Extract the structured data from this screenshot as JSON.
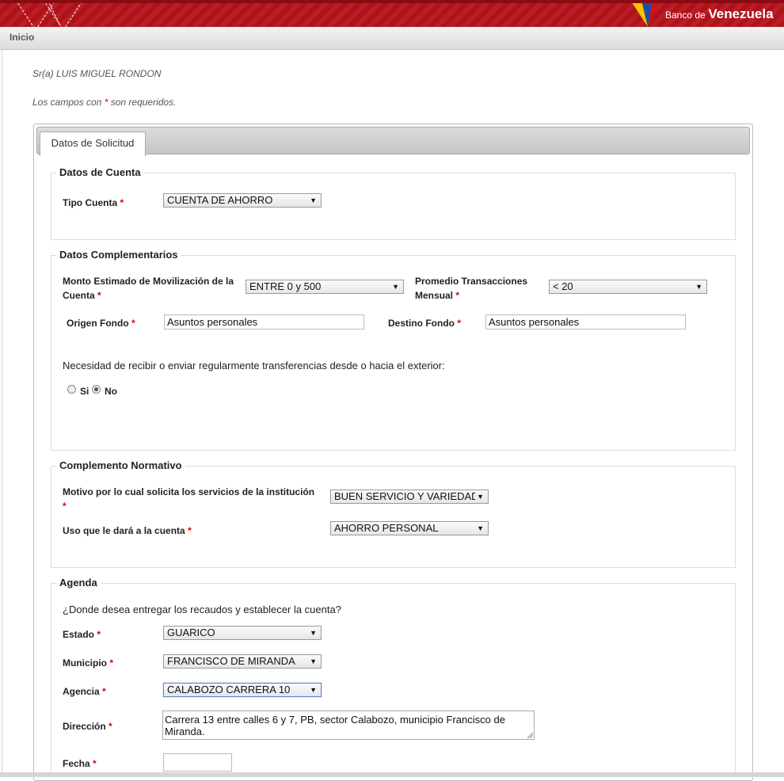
{
  "header": {
    "brand_small": "Banco de",
    "brand_big": "Venezuela"
  },
  "nav": {
    "home": "Inicio"
  },
  "greeting": "Sr(a) LUIS MIGUEL RONDON",
  "required_note": {
    "before": "Los campos con ",
    "star": "*",
    "after": " son requeridos."
  },
  "tabs": [
    {
      "label": "Datos de Solicitud",
      "active": true
    }
  ],
  "star": "*",
  "datos_cuenta": {
    "legend": "Datos de Cuenta",
    "tipo_cuenta_label": "Tipo Cuenta",
    "tipo_cuenta_value": "CUENTA DE AHORRO"
  },
  "datos_complementarios": {
    "legend": "Datos Complementarios",
    "monto_label_1": "Monto Estimado de Movilización de la",
    "monto_label_2": "Cuenta",
    "monto_value": "ENTRE 0 y 500",
    "promedio_label_1": "Promedio Transacciones",
    "promedio_label_2": "Mensual",
    "promedio_value": "< 20",
    "origen_label": "Origen Fondo",
    "origen_value": "Asuntos personales",
    "destino_label": "Destino Fondo",
    "destino_value": "Asuntos personales",
    "transfer_question": "Necesidad de recibir o enviar regularmente transferencias desde o hacia el exterior:",
    "radio_si": "Si",
    "radio_no": "No",
    "selected": "No"
  },
  "complemento_normativo": {
    "legend": "Complemento Normativo",
    "motivo_label": "Motivo por lo cual solicita los servicios de la institución",
    "motivo_value": "BUEN SERVICIO Y VARIEDAD",
    "uso_label": "Uso que le dará a la cuenta",
    "uso_value": "AHORRO PERSONAL"
  },
  "agenda": {
    "legend": "Agenda",
    "question": "¿Donde desea entregar los recaudos y establecer la cuenta?",
    "estado_label": "Estado",
    "estado_value": "GUARICO",
    "municipio_label": "Municipio",
    "municipio_value": "FRANCISCO DE MIRANDA",
    "agencia_label": "Agencia",
    "agencia_value": "CALABOZO CARRERA 10",
    "direccion_label": "Dirección",
    "direccion_value": "Carrera 13 entre calles 6 y 7, PB, sector Calabozo, municipio Francisco de Miranda.",
    "fecha_label": "Fecha",
    "fecha_value": ""
  },
  "colors": {
    "banner_red": "#b5121b",
    "required_red": "#dd0000",
    "flag_yellow": "#f7c600",
    "flag_blue": "#1f4ea0",
    "flag_red": "#d0101a"
  }
}
